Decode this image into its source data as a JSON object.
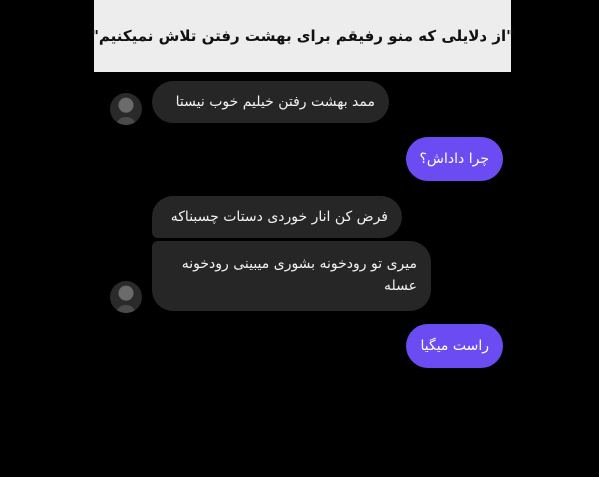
{
  "caption": "\"از دلایلی که منو رفیقم برای بهشت رفتن تلاش نمیکنیم\"",
  "messages": [
    {
      "side": "incoming",
      "text": "ممد بهشت رفتن خیلیم خوب نیستا"
    },
    {
      "side": "outgoing",
      "text": "چرا داداش؟"
    },
    {
      "side": "incoming",
      "text": "فرض کن انار خوردی دستات چسبناکه"
    },
    {
      "side": "incoming",
      "text": "میری تو رودخونه بشوری میبینی رودخونه عسله"
    },
    {
      "side": "outgoing",
      "text": "راست میگیا"
    }
  ],
  "colors": {
    "background": "#000000",
    "incoming_bubble": "#262626",
    "outgoing_bubble": "#6b4cf2",
    "caption_bar": "#ededed"
  }
}
